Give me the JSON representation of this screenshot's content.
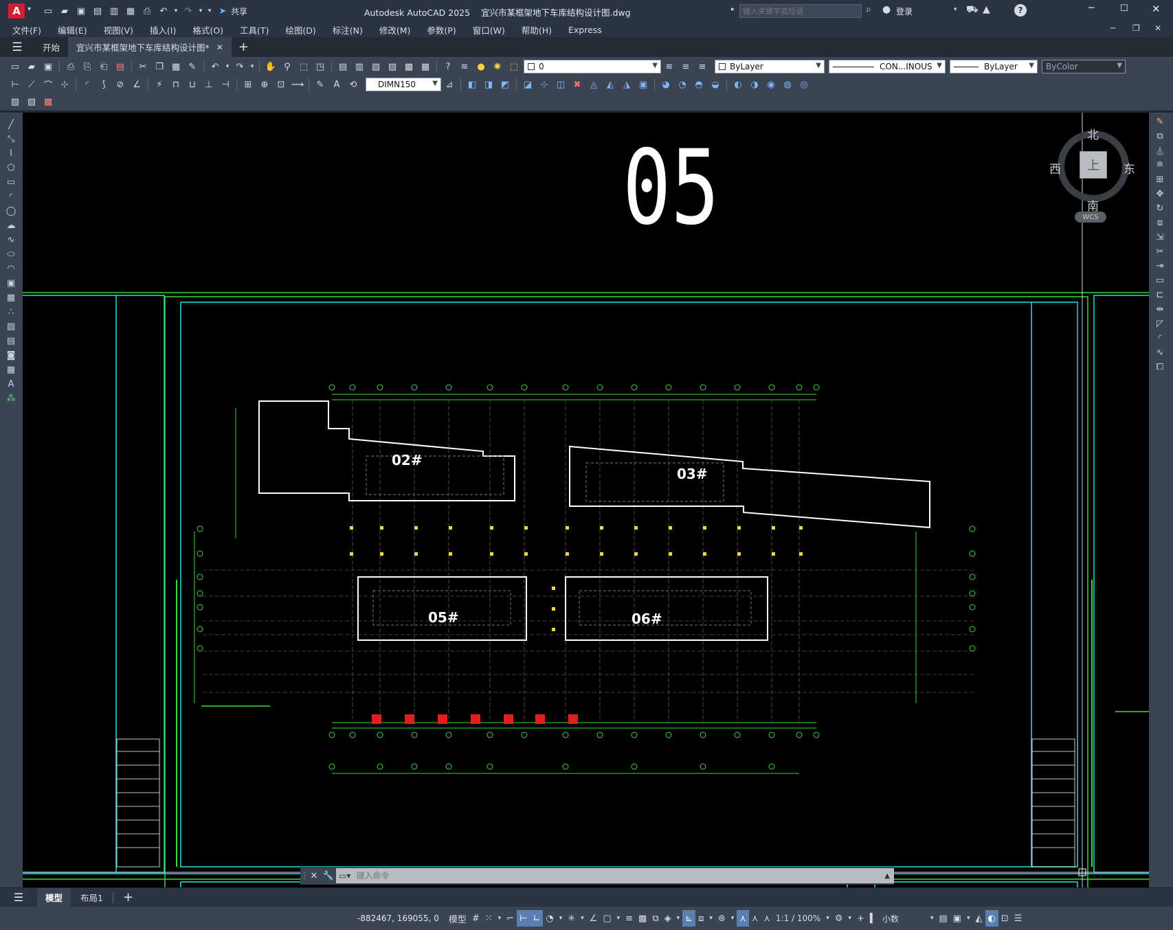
{
  "app": {
    "title": "Autodesk AutoCAD 2025",
    "document": "宜兴市某框架地下车库结构设计图.dwg",
    "search_placeholder": "键入关键字或短语",
    "login": "登录",
    "share": "共享"
  },
  "menu": [
    "文件(F)",
    "编辑(E)",
    "视图(V)",
    "插入(I)",
    "格式(O)",
    "工具(T)",
    "绘图(D)",
    "标注(N)",
    "修改(M)",
    "参数(P)",
    "窗口(W)",
    "帮助(H)",
    "Express"
  ],
  "tabs": {
    "start": "开始",
    "doc": "宜兴市某框架地下车库结构设计图*"
  },
  "toolbar": {
    "layer": "0",
    "color": "ByLayer",
    "linetype": "CON...INOUS",
    "lineweight": "ByLayer",
    "plotstyle": "ByColor",
    "dimstyle": "DIMN150"
  },
  "viewcube": {
    "north": "北",
    "south": "南",
    "east": "东",
    "west": "西",
    "top": "上",
    "wcs": "WCS"
  },
  "drawing": {
    "sheet_number": "05",
    "buildings": [
      "02#",
      "03#",
      "05#",
      "06#"
    ]
  },
  "command": {
    "placeholder": "键入命令"
  },
  "layout": {
    "model": "模型",
    "layout1": "布局1"
  },
  "status": {
    "coords": "-882467, 169055, 0",
    "model": "模型",
    "scale": "1:1 / 100%",
    "units": "小数"
  }
}
